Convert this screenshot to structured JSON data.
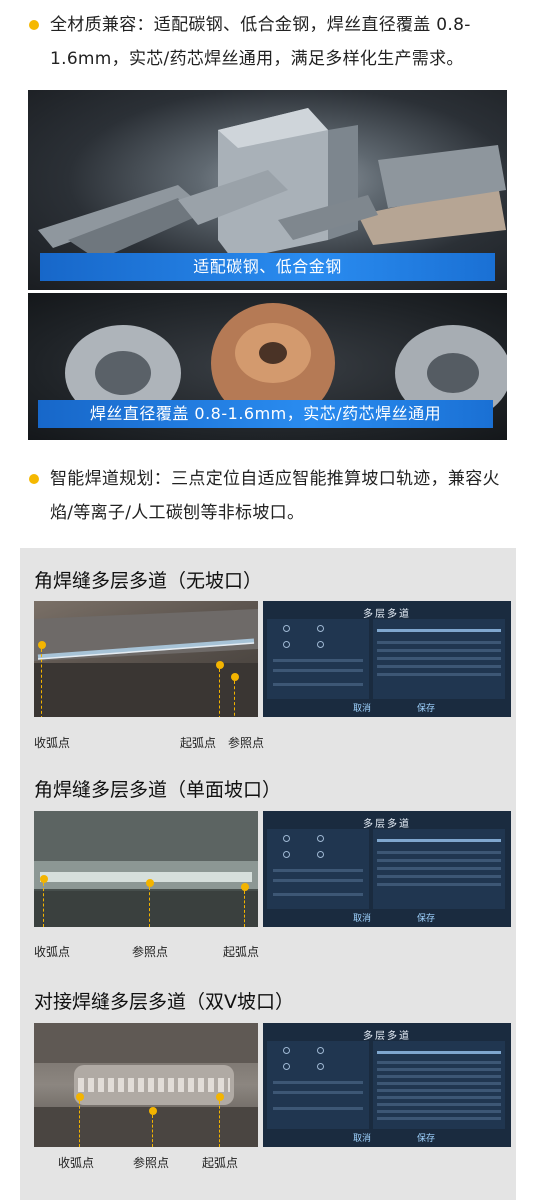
{
  "bullets": [
    {
      "text": "全材质兼容：适配碳钢、低合金钢，焊丝直径覆盖 0.8-1.6mm，实芯/药芯焊丝通用，满足多样化生产需求。"
    },
    {
      "text": "智能焊道规划：三点定位自适应智能推算坡口轨迹，兼容火焰/等离子/人工碳刨等非标坡口。"
    }
  ],
  "photos": {
    "banner1": "适配碳钢、低合金钢",
    "banner2": "焊丝直径覆盖 0.8-1.6mm，实芯/药芯焊丝通用"
  },
  "panels": [
    {
      "title": "角焊缝多层多道（无坡口）",
      "screen_title": "多层多道",
      "cancel": "取消",
      "save": "保存",
      "labels": [
        "收弧点",
        "起弧点",
        "参照点"
      ]
    },
    {
      "title": "角焊缝多层多道（单面坡口）",
      "screen_title": "多层多道",
      "cancel": "取消",
      "save": "保存",
      "labels": [
        "收弧点",
        "参照点",
        "起弧点"
      ]
    },
    {
      "title": "对接焊缝多层多道（双V坡口）",
      "screen_title": "多层多道",
      "cancel": "取消",
      "save": "保存",
      "labels": [
        "收弧点",
        "参照点",
        "起弧点"
      ]
    }
  ],
  "colors": {
    "accent": "#f5b800",
    "banner_blue": "#1e78e0",
    "panel_bg": "#e4e4e4",
    "screen_bg": "#1a2b3f"
  }
}
